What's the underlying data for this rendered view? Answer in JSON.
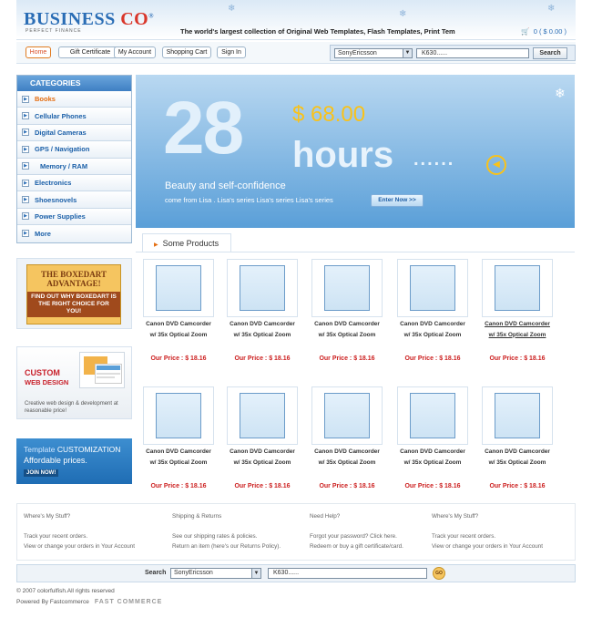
{
  "brand": {
    "logo_main": "BUSINESS ",
    "logo_accent": "CO",
    "logo_mark": "®",
    "logo_sub": "PERFECT FINANCE",
    "tagline": "The world's largest collection of Original Web Templates, Flash Templates, Print Tem",
    "cart_summary": "0  ( $ 0.00 )"
  },
  "nav": {
    "home": "Home",
    "gift": "Gift Certificate",
    "account": "My Account",
    "cart": "Shopping Cart",
    "signin": "Sign In"
  },
  "top_search": {
    "selected": "SonyEricsson",
    "query": "K630......",
    "button": "Search"
  },
  "categories": {
    "title": "CATEGORIES",
    "items": [
      {
        "label": "Books"
      },
      {
        "label": "Cellular Phones"
      },
      {
        "label": "Digital Cameras"
      },
      {
        "label": "GPS / Navigation"
      },
      {
        "label": "Memory / RAM"
      },
      {
        "label": "Electronics"
      },
      {
        "label": "Shoesnovels"
      },
      {
        "label": "Power Supplies"
      },
      {
        "label": "More"
      }
    ]
  },
  "ads": {
    "boxedart_line1": "THE BOXEDART",
    "boxedart_line2": "ADVANTAGE!",
    "boxedart_line3": "FIND OUT WHY BOXEDART IS THE RIGHT CHOICE FOR YOU!",
    "custom_line1": "CUSTOM",
    "custom_line2": "WEB DESIGN",
    "custom_desc": "Creative web design & development at reasonable price!",
    "template_line1a": "Template ",
    "template_line1b": "CUSTOMIZATION",
    "template_line2": "Affordable prices.",
    "template_join": "JOIN NOW!"
  },
  "banner": {
    "big": "28",
    "price": "$ 68.00",
    "hours": "hours",
    "dots": "......",
    "headline": "Beauty and self-confidence",
    "sub": "come from Lisa . Lisa's series Lisa's series Lisa's series",
    "enter": "Enter Now >>"
  },
  "products": {
    "tab": "Some Products",
    "items": [
      {
        "name": "Canon DVD Camcorder w/ 35x Optical Zoom",
        "price": "Our Price : $ 18.16"
      },
      {
        "name": "Canon DVD Camcorder w/ 35x Optical Zoom",
        "price": "Our Price : $ 18.16"
      },
      {
        "name": "Canon DVD Camcorder w/ 35x Optical Zoom",
        "price": "Our Price : $ 18.16"
      },
      {
        "name": "Canon DVD Camcorder w/ 35x Optical Zoom",
        "price": "Our Price : $ 18.16"
      },
      {
        "name": "Canon DVD Camcorder w/ 35x Optical Zoom",
        "price": "Our Price : $ 18.16"
      },
      {
        "name": "Canon DVD Camcorder w/ 35x Optical Zoom",
        "price": "Our Price : $ 18.16"
      },
      {
        "name": "Canon DVD Camcorder w/ 35x Optical Zoom",
        "price": "Our Price : $ 18.16"
      },
      {
        "name": "Canon DVD Camcorder w/ 35x Optical Zoom",
        "price": "Our Price : $ 18.16"
      },
      {
        "name": "Canon DVD Camcorder w/ 35x Optical Zoom",
        "price": "Our Price : $ 18.16"
      },
      {
        "name": "Canon DVD Camcorder w/ 35x Optical Zoom",
        "price": "Our Price : $ 18.16"
      }
    ]
  },
  "footer": {
    "col1": {
      "head": "Where's My Stuff?",
      "l1": "Track your recent orders.",
      "l2": "View or change your orders in Your Account"
    },
    "col2": {
      "head": "Shipping & Returns",
      "l1": "See our shipping rates & policies.",
      "l2": "Return an item (here's our Returns Policy)."
    },
    "col3": {
      "head": "Need Help?",
      "l1": "Forgot your password? Click here.",
      "l2": "Redeem or buy a gift certificate/card."
    },
    "col4": {
      "head": "Where's My Stuff?",
      "l1": "Track your recent orders.",
      "l2": "View or change your orders in Your Account"
    },
    "search_label": "Search",
    "search_selected": "SonyEricsson",
    "search_query": "K630......",
    "go": "GO",
    "copyright": "© 2007 colorfulfish.All rights reserved",
    "powered": "Powered  By Fastcommerce",
    "fc_logo": "FAST COMMERCE"
  }
}
